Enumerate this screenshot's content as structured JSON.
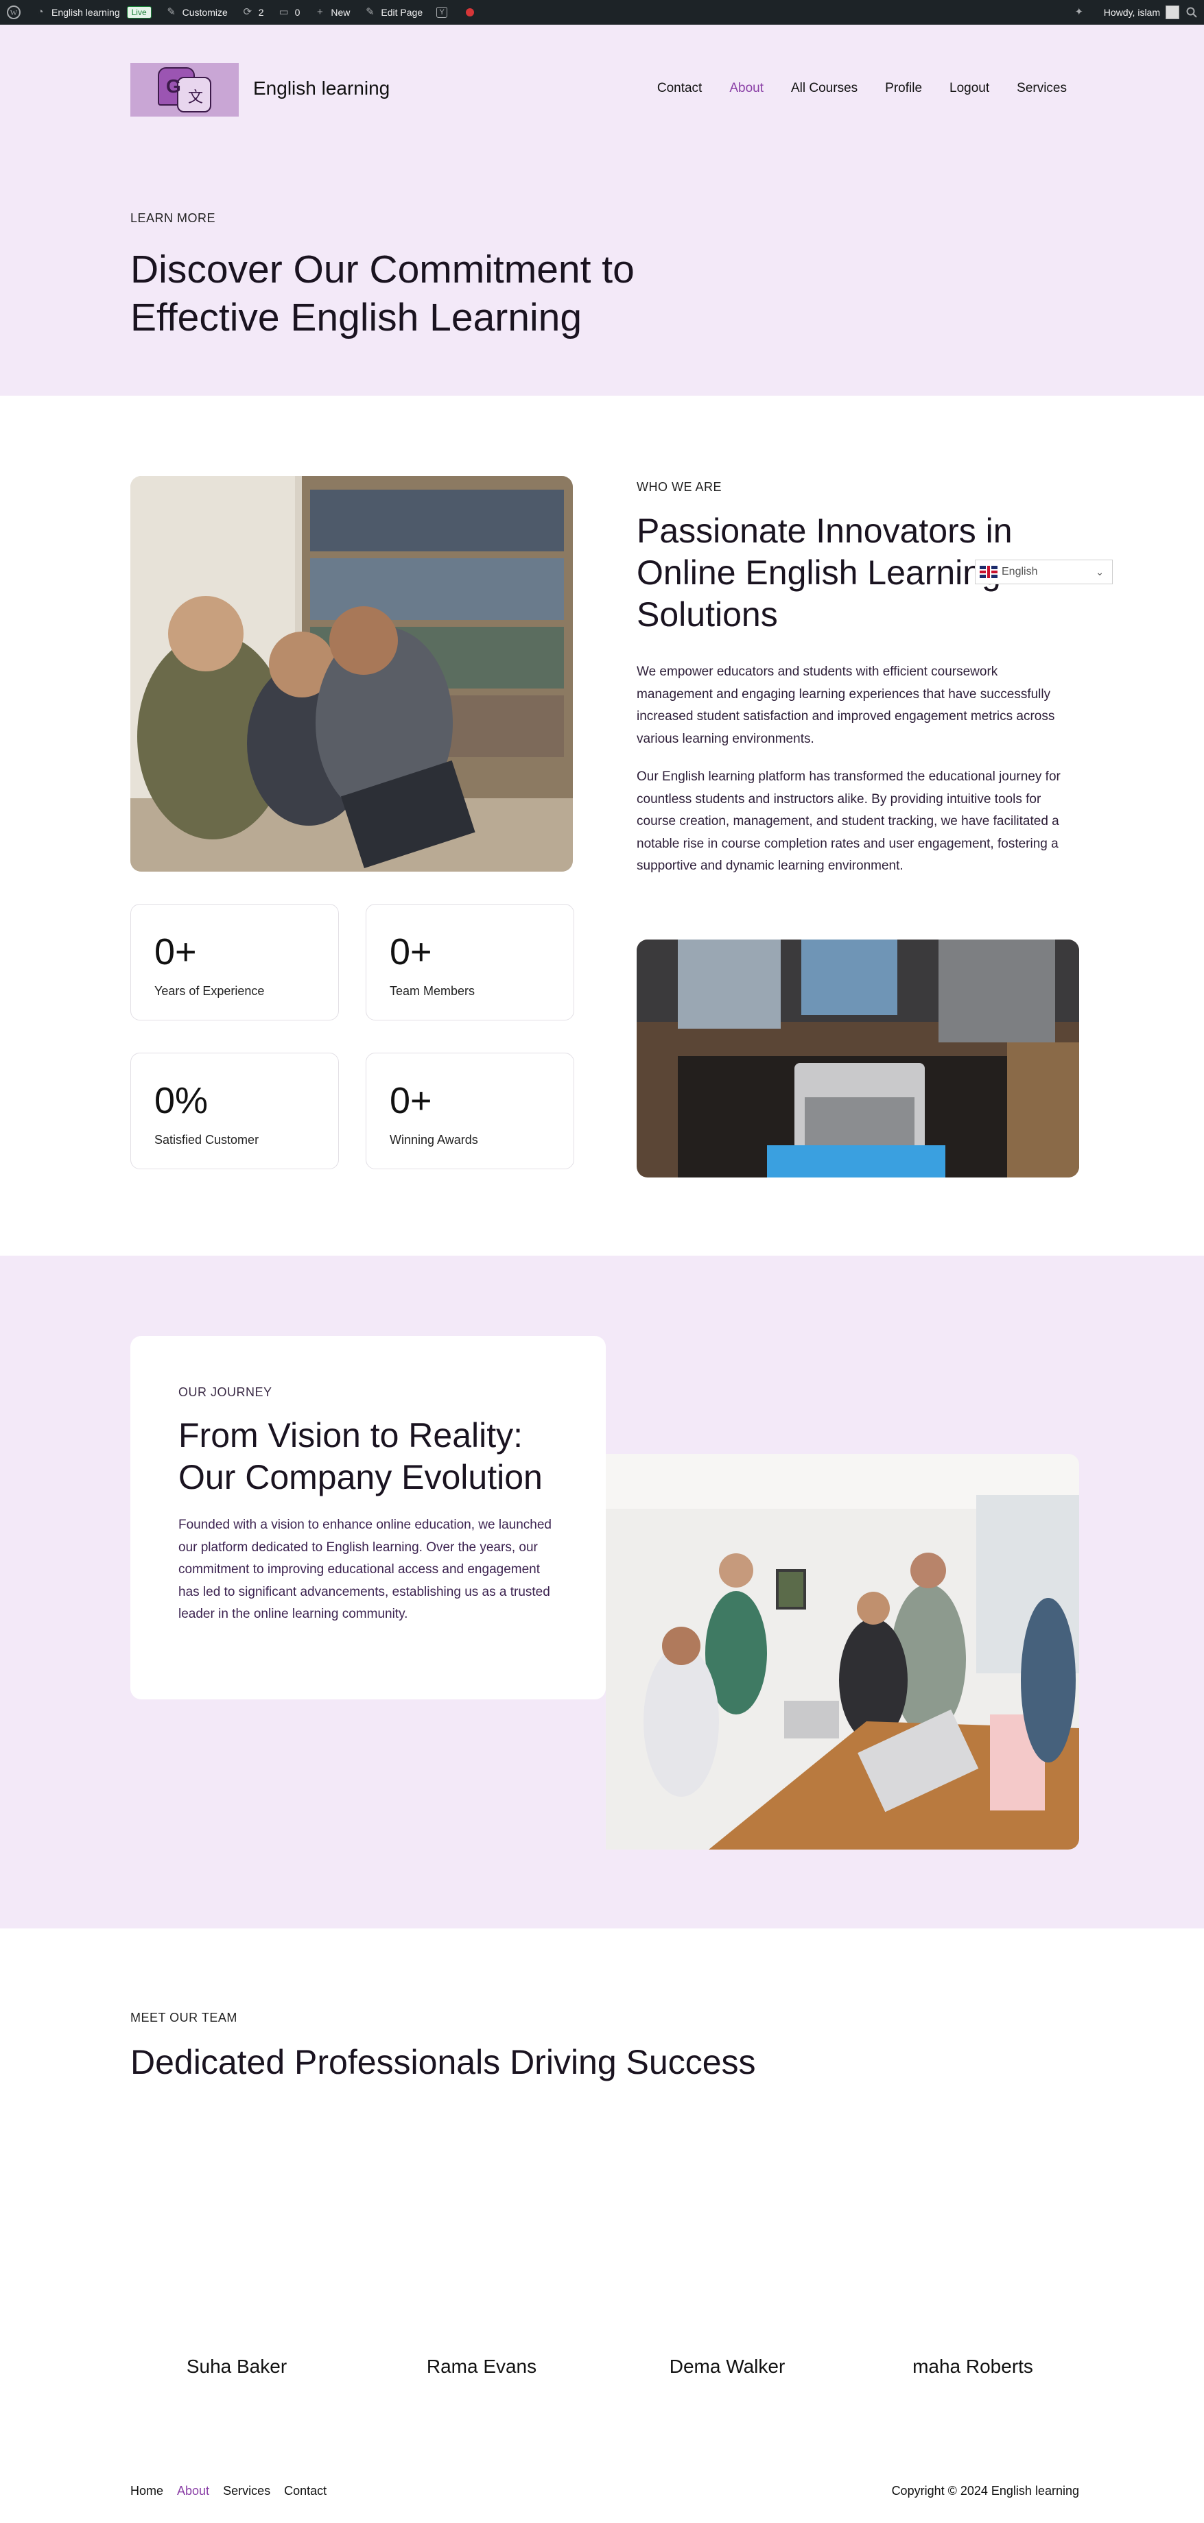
{
  "admin_bar": {
    "site_name": "English learning",
    "live_badge": "Live",
    "customize": "Customize",
    "updates_count": "2",
    "comments_count": "0",
    "new_label": "New",
    "edit_page": "Edit Page",
    "howdy": "Howdy, islam"
  },
  "header": {
    "site_title": "English learning",
    "nav": [
      "Contact",
      "About",
      "All Courses",
      "Profile",
      "Logout",
      "Services"
    ],
    "active_nav": "About"
  },
  "hero": {
    "eyebrow": "LEARN MORE",
    "title": "Discover Our Commitment to Effective English Learning"
  },
  "who_we_are": {
    "eyebrow": "WHO WE ARE",
    "title": "Passionate Innovators in Online English Learning Solutions",
    "paragraph_1": "We empower educators and students with efficient coursework management and engaging learning experiences that have successfully increased student satisfaction and improved engagement metrics across various learning environments.",
    "paragraph_2": "Our English learning platform has transformed the educational journey for countless students and instructors alike. By providing intuitive tools for course creation, management, and student tracking, we have facilitated a notable rise in course completion rates and user engagement, fostering a supportive and dynamic learning environment.",
    "stats": [
      {
        "value": "0+",
        "label": "Years of Experience"
      },
      {
        "value": "0+",
        "label": "Team Members"
      },
      {
        "value": "0%",
        "label": "Satisfied Customer"
      },
      {
        "value": "0+",
        "label": "Winning Awards"
      }
    ]
  },
  "language_switcher": {
    "selected": "English"
  },
  "journey": {
    "eyebrow": "OUR JOURNEY",
    "title": "From Vision to Reality: Our Company Evolution",
    "paragraph": "Founded with a vision to enhance online education, we launched our platform dedicated to English learning. Over the years, our commitment to improving educational access and engagement has led to significant advancements, establishing us as a trusted leader in the online learning community."
  },
  "team": {
    "eyebrow": "MEET OUR TEAM",
    "title": "Dedicated Professionals Driving Success",
    "members": [
      "Suha Baker",
      "Rama Evans",
      "Dema Walker",
      "maha Roberts"
    ]
  },
  "footer": {
    "links": [
      "Home",
      "About",
      "Services",
      "Contact"
    ],
    "active_link": "About",
    "copyright": "Copyright © 2024 English learning"
  },
  "colors": {
    "accent": "#8a3fa6",
    "hero_bg": "#f3e9f8",
    "admin_bar": "#1d2327"
  }
}
